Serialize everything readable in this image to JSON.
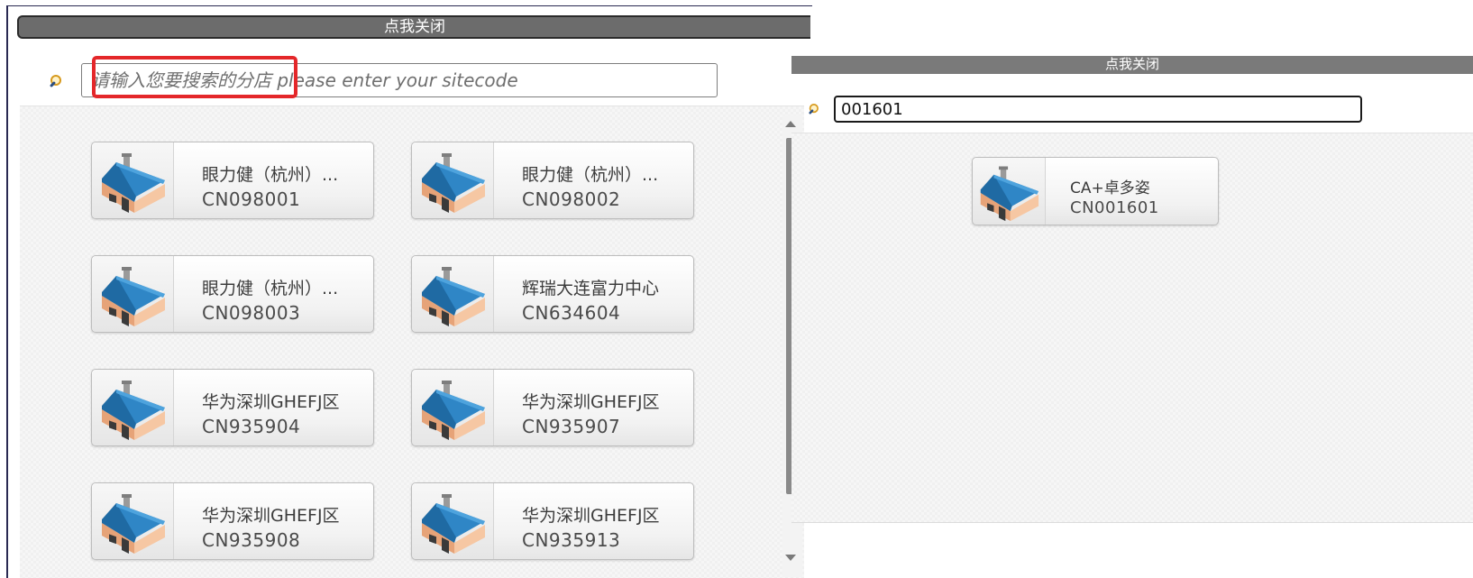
{
  "left_panel": {
    "close_label": "点我关闭",
    "search_placeholder": "请输入您要搜索的分店 please enter your sitecode",
    "stores": [
      {
        "name": "眼力健（杭州）...",
        "code": "CN098001"
      },
      {
        "name": "眼力健（杭州）...",
        "code": "CN098002"
      },
      {
        "name": "眼力健（杭州）...",
        "code": "CN098003"
      },
      {
        "name": "辉瑞大连富力中心",
        "code": "CN634604"
      },
      {
        "name": "华为深圳GHEFJ区",
        "code": "CN935904"
      },
      {
        "name": "华为深圳GHEFJ区",
        "code": "CN935907"
      },
      {
        "name": "华为深圳GHEFJ区",
        "code": "CN935908"
      },
      {
        "name": "华为深圳GHEFJ区",
        "code": "CN935913"
      }
    ]
  },
  "right_panel": {
    "close_label": "点我关闭",
    "search_value": "001601",
    "stores": [
      {
        "name": "CA+卓多姿",
        "code": "CN001601"
      }
    ]
  },
  "colors": {
    "highlight": "#e4272a",
    "close_bar": "#6c6c6c",
    "roof": "#2f86c6",
    "wall": "#f2b48a"
  },
  "icons": {
    "search": "magnifier-icon",
    "store": "house-icon"
  }
}
